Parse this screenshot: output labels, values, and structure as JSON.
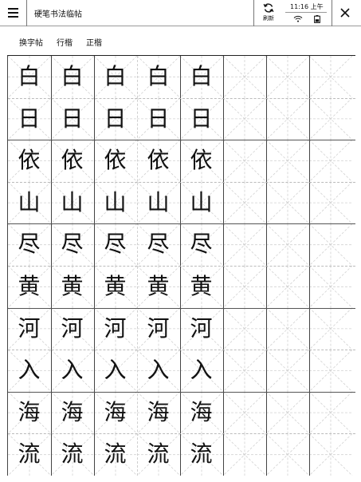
{
  "app": {
    "title": "硬笔书法临帖",
    "refresh_label": "刷新",
    "time": "11:16 上午"
  },
  "icons": {
    "menu": "menu-icon",
    "refresh": "refresh-icon",
    "wifi": "wifi-icon",
    "battery": "battery-icon",
    "close": "close-icon"
  },
  "tabs": [
    {
      "label": "换字帖"
    },
    {
      "label": "行楷"
    },
    {
      "label": "正楷"
    }
  ],
  "copybook": {
    "practice_columns": 5,
    "rows": [
      {
        "char": "白"
      },
      {
        "char": "日"
      },
      {
        "char": "依"
      },
      {
        "char": "山"
      },
      {
        "char": "尽"
      },
      {
        "char": "黄"
      },
      {
        "char": "河"
      },
      {
        "char": "入"
      },
      {
        "char": "海"
      },
      {
        "char": "流"
      }
    ]
  }
}
